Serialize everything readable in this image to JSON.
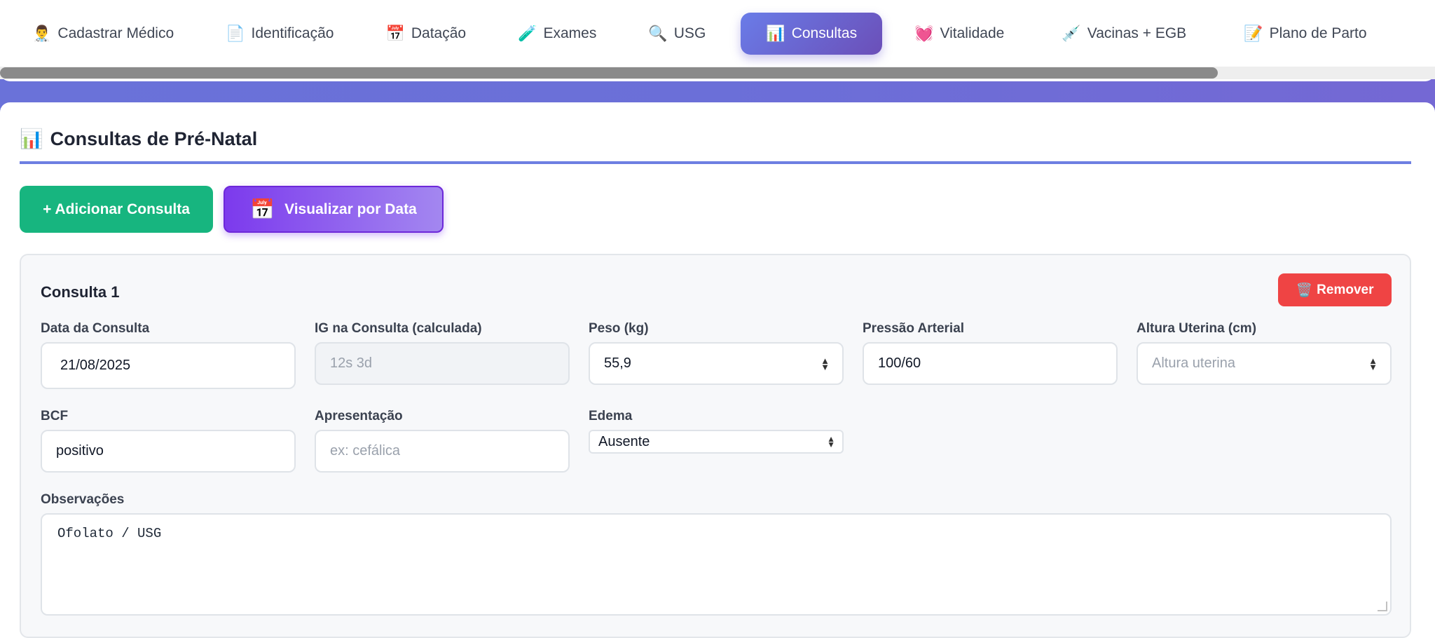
{
  "nav": {
    "tabs": [
      {
        "label": "Cadastrar Médico",
        "icon": "👨‍⚕️"
      },
      {
        "label": "Identificação",
        "icon": "📄"
      },
      {
        "label": "Datação",
        "icon": "📅"
      },
      {
        "label": "Exames",
        "icon": "🧪"
      },
      {
        "label": "USG",
        "icon": "🔍"
      },
      {
        "label": "Consultas",
        "icon": "📊",
        "active": true
      },
      {
        "label": "Vitalidade",
        "icon": "💓"
      },
      {
        "label": "Vacinas + EGB",
        "icon": "💉"
      },
      {
        "label": "Plano de Parto",
        "icon": "📝"
      }
    ]
  },
  "section": {
    "icon": "📊",
    "title": "Consultas de Pré-Natal"
  },
  "actions": {
    "add_label": "+ Adicionar Consulta",
    "view_icon": "📅",
    "view_label": "Visualizar por Data"
  },
  "consulta": {
    "title": "Consulta 1",
    "remove_icon": "🗑️",
    "remove_label": "Remover",
    "fields": {
      "data_label": "Data da Consulta",
      "data_value": "21/08/2025",
      "ig_label": "IG na Consulta (calculada)",
      "ig_placeholder": "12s 3d",
      "peso_label": "Peso (kg)",
      "peso_value": "55,9",
      "pa_label": "Pressão Arterial",
      "pa_value": "100/60",
      "au_label": "Altura Uterina (cm)",
      "au_placeholder": "Altura uterina",
      "bcf_label": "BCF",
      "bcf_value": "positivo",
      "apres_label": "Apresentação",
      "apres_placeholder": "ex: cefálica",
      "edema_label": "Edema",
      "edema_value": "Ausente",
      "obs_label": "Observações",
      "obs_value": "Ofolato / USG"
    }
  },
  "colors": {
    "accent": "#6d7fe2",
    "add_button": "#17b57f",
    "view_button": "#7c3aed",
    "remove_button": "#ef4444"
  }
}
